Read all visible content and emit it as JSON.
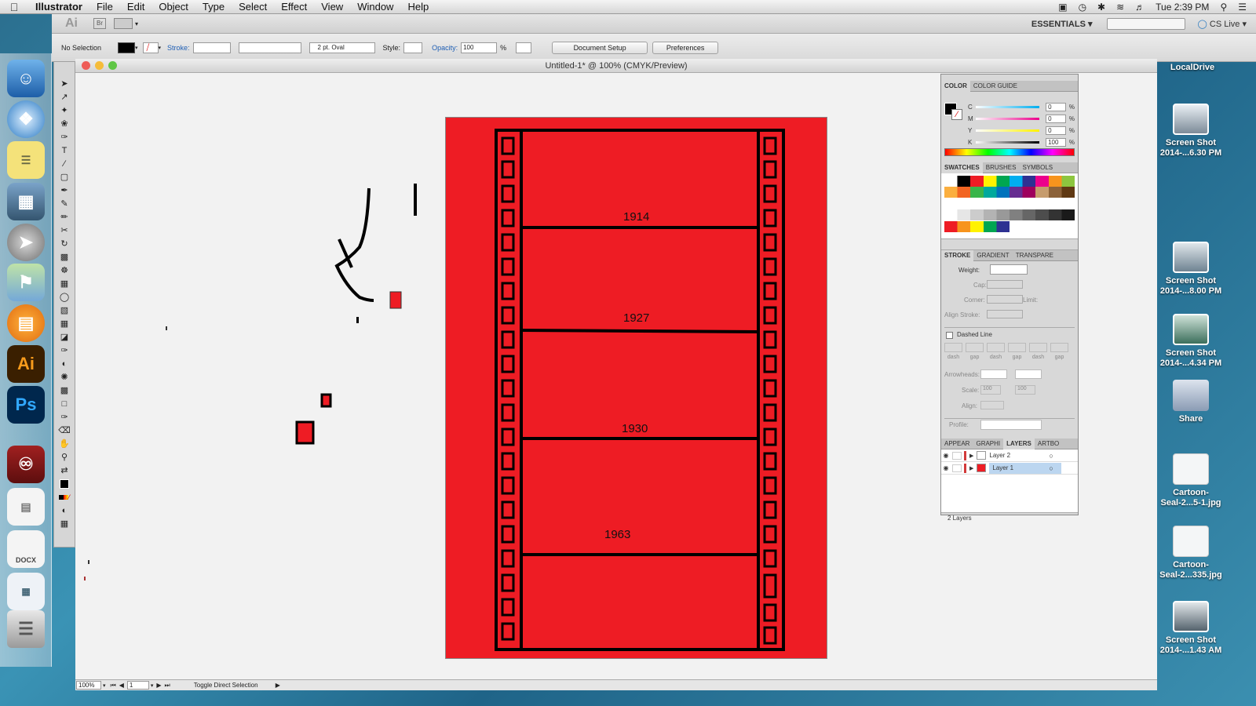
{
  "menubar": {
    "app_name": "Illustrator",
    "items": [
      "File",
      "Edit",
      "Object",
      "Type",
      "Select",
      "Effect",
      "View",
      "Window",
      "Help"
    ],
    "clock": "Tue 2:39 PM"
  },
  "appbar": {
    "logo": "Ai",
    "bridge": "Br",
    "workspace": "ESSENTIALS",
    "cs_live": "CS Live"
  },
  "control_bar": {
    "selection": "No Selection",
    "stroke_label": "Stroke:",
    "brush": "2 pt. Oval",
    "style_label": "Style:",
    "opacity_label": "Opacity:",
    "opacity_value": "100",
    "percent": "%",
    "document_setup": "Document Setup",
    "preferences": "Preferences"
  },
  "document": {
    "title": "Untitled-1* @ 100% (CMYK/Preview)",
    "zoom": "100%",
    "artboard_num": "1",
    "status_text": "Toggle Direct Selection"
  },
  "artwork": {
    "labels": [
      "1914",
      "1927",
      "1930",
      "1963"
    ]
  },
  "color_panel": {
    "tabs": [
      "COLOR",
      "COLOR GUIDE"
    ],
    "channels": [
      {
        "name": "C",
        "value": "0"
      },
      {
        "name": "M",
        "value": "0"
      },
      {
        "name": "Y",
        "value": "0"
      },
      {
        "name": "K",
        "value": "100"
      }
    ],
    "percent": "%"
  },
  "swatches_panel": {
    "tabs": [
      "SWATCHES",
      "BRUSHES",
      "SYMBOLS"
    ]
  },
  "stroke_panel": {
    "tabs": [
      "STROKE",
      "GRADIENT",
      "TRANSPARE"
    ],
    "weight": "Weight:",
    "cap": "Cap:",
    "corner": "Corner:",
    "limit": "Limit:",
    "align_stroke": "Align Stroke:",
    "dashed_line": "Dashed Line",
    "dash_labels": [
      "dash",
      "gap",
      "dash",
      "gap",
      "dash",
      "gap"
    ],
    "arrowheads": "Arrowheads:",
    "scale": "Scale:",
    "scale_value_1": "100",
    "scale_value_2": "100",
    "align": "Align:",
    "profile": "Profile:"
  },
  "layers_panel": {
    "tabs": [
      "APPEAR",
      "GRAPHI",
      "LAYERS",
      "ARTBO"
    ],
    "layers": [
      {
        "name": "Layer 2",
        "color": "#d23a3a"
      },
      {
        "name": "Layer 1",
        "color": "#d23a3a"
      }
    ],
    "count": "2 Layers"
  },
  "desktop": {
    "local_drive": "LocalDrive",
    "items": [
      {
        "line1": "Screen Shot",
        "line2": "2014-...6.30 PM"
      },
      {
        "line1": "Screen Shot",
        "line2": "2014-...8.00 PM"
      },
      {
        "line1": "Screen Shot",
        "line2": "2014-...4.34 PM"
      },
      {
        "line1": "Share",
        "line2": ""
      },
      {
        "line1": "Cartoon-",
        "line2": "Seal-2...5-1.jpg"
      },
      {
        "line1": "Cartoon-",
        "line2": "Seal-2...335.jpg"
      },
      {
        "line1": "Screen Shot",
        "line2": "2014-...1.43 AM"
      }
    ]
  },
  "dock": {
    "ai_label": "Ai",
    "ps_label": "Ps",
    "docx_label": "DOCX"
  }
}
